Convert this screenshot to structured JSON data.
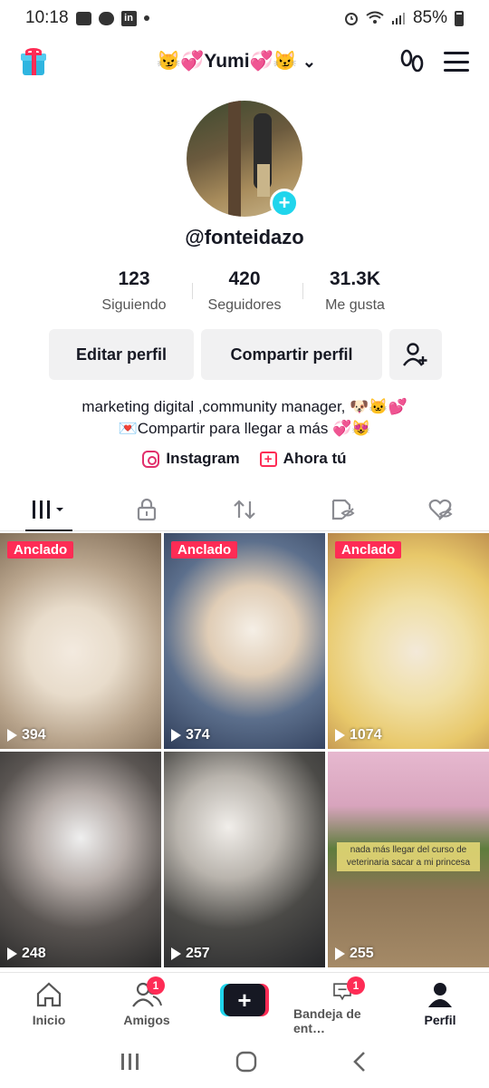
{
  "statusbar": {
    "time": "10:18",
    "li_text": "in",
    "battery": "85%"
  },
  "header": {
    "username": "😼💞Yumi💞😼",
    "chevron": "⌄"
  },
  "profile": {
    "handle": "@fonteidazo",
    "plus": "+"
  },
  "stats": [
    {
      "num": "123",
      "label": "Siguiendo"
    },
    {
      "num": "420",
      "label": "Seguidores"
    },
    {
      "num": "31.3K",
      "label": "Me gusta"
    }
  ],
  "actions": {
    "edit": "Editar perfil",
    "share": "Compartir perfil"
  },
  "bio": {
    "line1": "marketing digital ,community manager, 🐶🐱💕",
    "line2": "💌Compartir para llegar a más 💞😻"
  },
  "links": {
    "instagram": "Instagram",
    "ahora": "Ahora tú",
    "add_symbol": "+"
  },
  "videos": [
    {
      "pinned": "Anclado",
      "views": "394",
      "caption": ""
    },
    {
      "pinned": "Anclado",
      "views": "374",
      "caption": ""
    },
    {
      "pinned": "Anclado",
      "views": "1074",
      "caption": ""
    },
    {
      "pinned": "",
      "views": "248",
      "caption": ""
    },
    {
      "pinned": "",
      "views": "257",
      "caption": ""
    },
    {
      "pinned": "",
      "views": "255",
      "caption": "nada más llegar del curso de veterinaria sacar a mi princesa"
    }
  ],
  "nav": [
    {
      "label": "Inicio",
      "badge": ""
    },
    {
      "label": "Amigos",
      "badge": "1"
    },
    {
      "label": "",
      "badge": "",
      "symbol": "+"
    },
    {
      "label": "Bandeja de ent…",
      "badge": "1"
    },
    {
      "label": "Perfil",
      "badge": ""
    }
  ],
  "colors": {
    "accent": "#fe2c55",
    "cyan": "#20d5ec",
    "text": "#161823"
  },
  "icons": [
    "gift-icon",
    "footprints-icon",
    "menu-icon",
    "grid-icon",
    "lock-icon",
    "repost-icon",
    "hidden-likes-icon",
    "heart-hidden-icon"
  ]
}
